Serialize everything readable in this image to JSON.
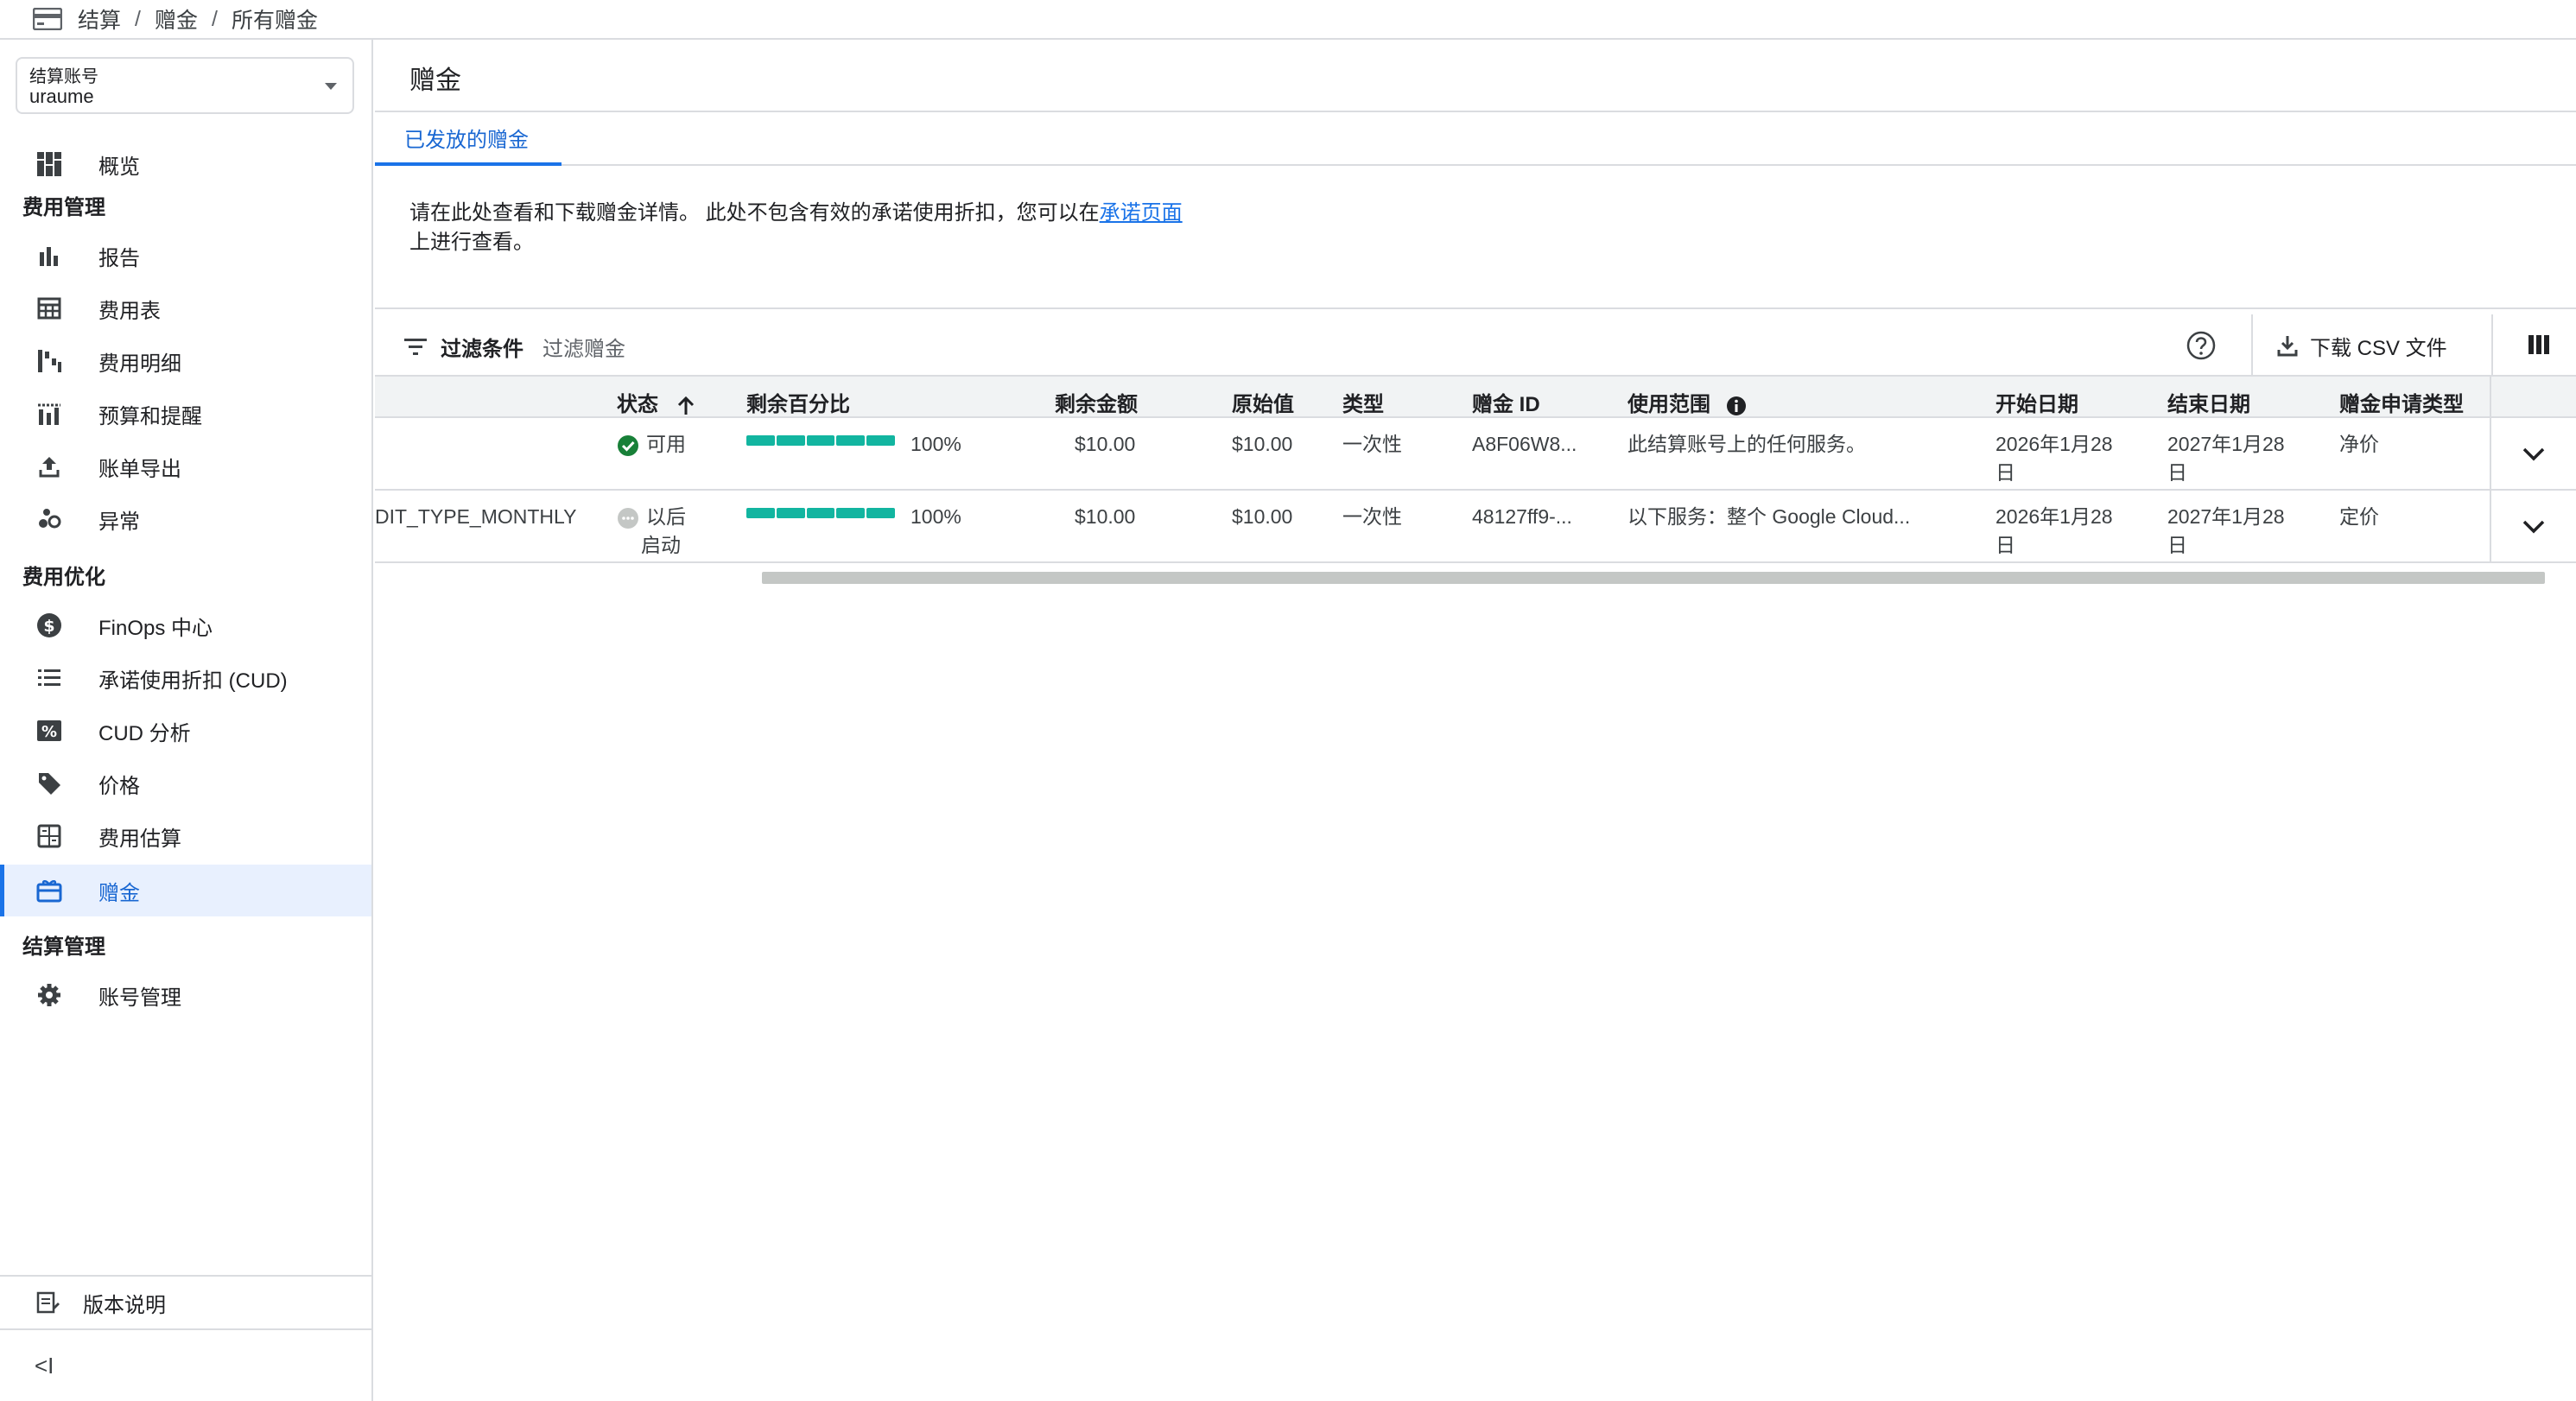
{
  "breadcrumb": {
    "items": [
      "结算",
      "赠金",
      "所有赠金"
    ],
    "separator": "/"
  },
  "sidebar": {
    "account": {
      "label": "结算账号",
      "value": "uraume"
    },
    "overview": "概览",
    "sections": {
      "cost_mgmt": "费用管理",
      "cost_opt": "费用优化",
      "billing_mgmt": "结算管理"
    },
    "items": {
      "reports": "报告",
      "cost_table": "费用表",
      "cost_breakdown": "费用明细",
      "budgets": "预算和提醒",
      "export": "账单导出",
      "anomalies": "异常",
      "finops": "FinOps 中心",
      "cud": "承诺使用折扣 (CUD)",
      "cud_analysis": "CUD 分析",
      "pricing": "价格",
      "estimates": "费用估算",
      "credits": "赠金",
      "account_mgmt": "账号管理"
    },
    "release_notes": "版本说明",
    "collapse": "<I"
  },
  "main": {
    "title": "赠金",
    "tab": "已发放的赠金",
    "description_pre": "请在此处查看和下载赠金详情。 此处不包含有效的承诺使用折扣，您可以在",
    "description_link": "承诺页面",
    "description_post": "上进行查看。",
    "filter": {
      "label": "过滤条件",
      "placeholder": "过滤赠金"
    },
    "download": "下载 CSV 文件",
    "accent": "#1a73e8",
    "progress_color": "#12b5a0"
  },
  "table": {
    "headers": {
      "status": "状态",
      "remaining_pct": "剩余百分比",
      "remaining_amt": "剩余金额",
      "original": "原始值",
      "type": "类型",
      "id": "赠金 ID",
      "scope": "使用范围",
      "start": "开始日期",
      "end": "结束日期",
      "claim_type": "赠金申请类型"
    },
    "rows": [
      {
        "name": "",
        "status": "可用",
        "remaining_pct": "100%",
        "remaining_fraction": 1.0,
        "remaining_amt": "$10.00",
        "original": "$10.00",
        "type": "一次性",
        "id": "A8F06W8...",
        "scope": "此结算账号上的任何服务。",
        "start_line1": "2026年1月28",
        "start_line2": "日",
        "end_line1": "2027年1月28",
        "end_line2": "日",
        "claim_type": "净价"
      },
      {
        "name": "DIT_TYPE_MONTHLY",
        "status_line1": "以后",
        "status_line2": "启动",
        "remaining_pct": "100%",
        "remaining_fraction": 1.0,
        "remaining_amt": "$10.00",
        "original": "$10.00",
        "type": "一次性",
        "id": "48127ff9-...",
        "scope": "以下服务：整个 Google Cloud...",
        "start_line1": "2026年1月28",
        "start_line2": "日",
        "end_line1": "2027年1月28",
        "end_line2": "日",
        "claim_type": "定价"
      }
    ]
  }
}
